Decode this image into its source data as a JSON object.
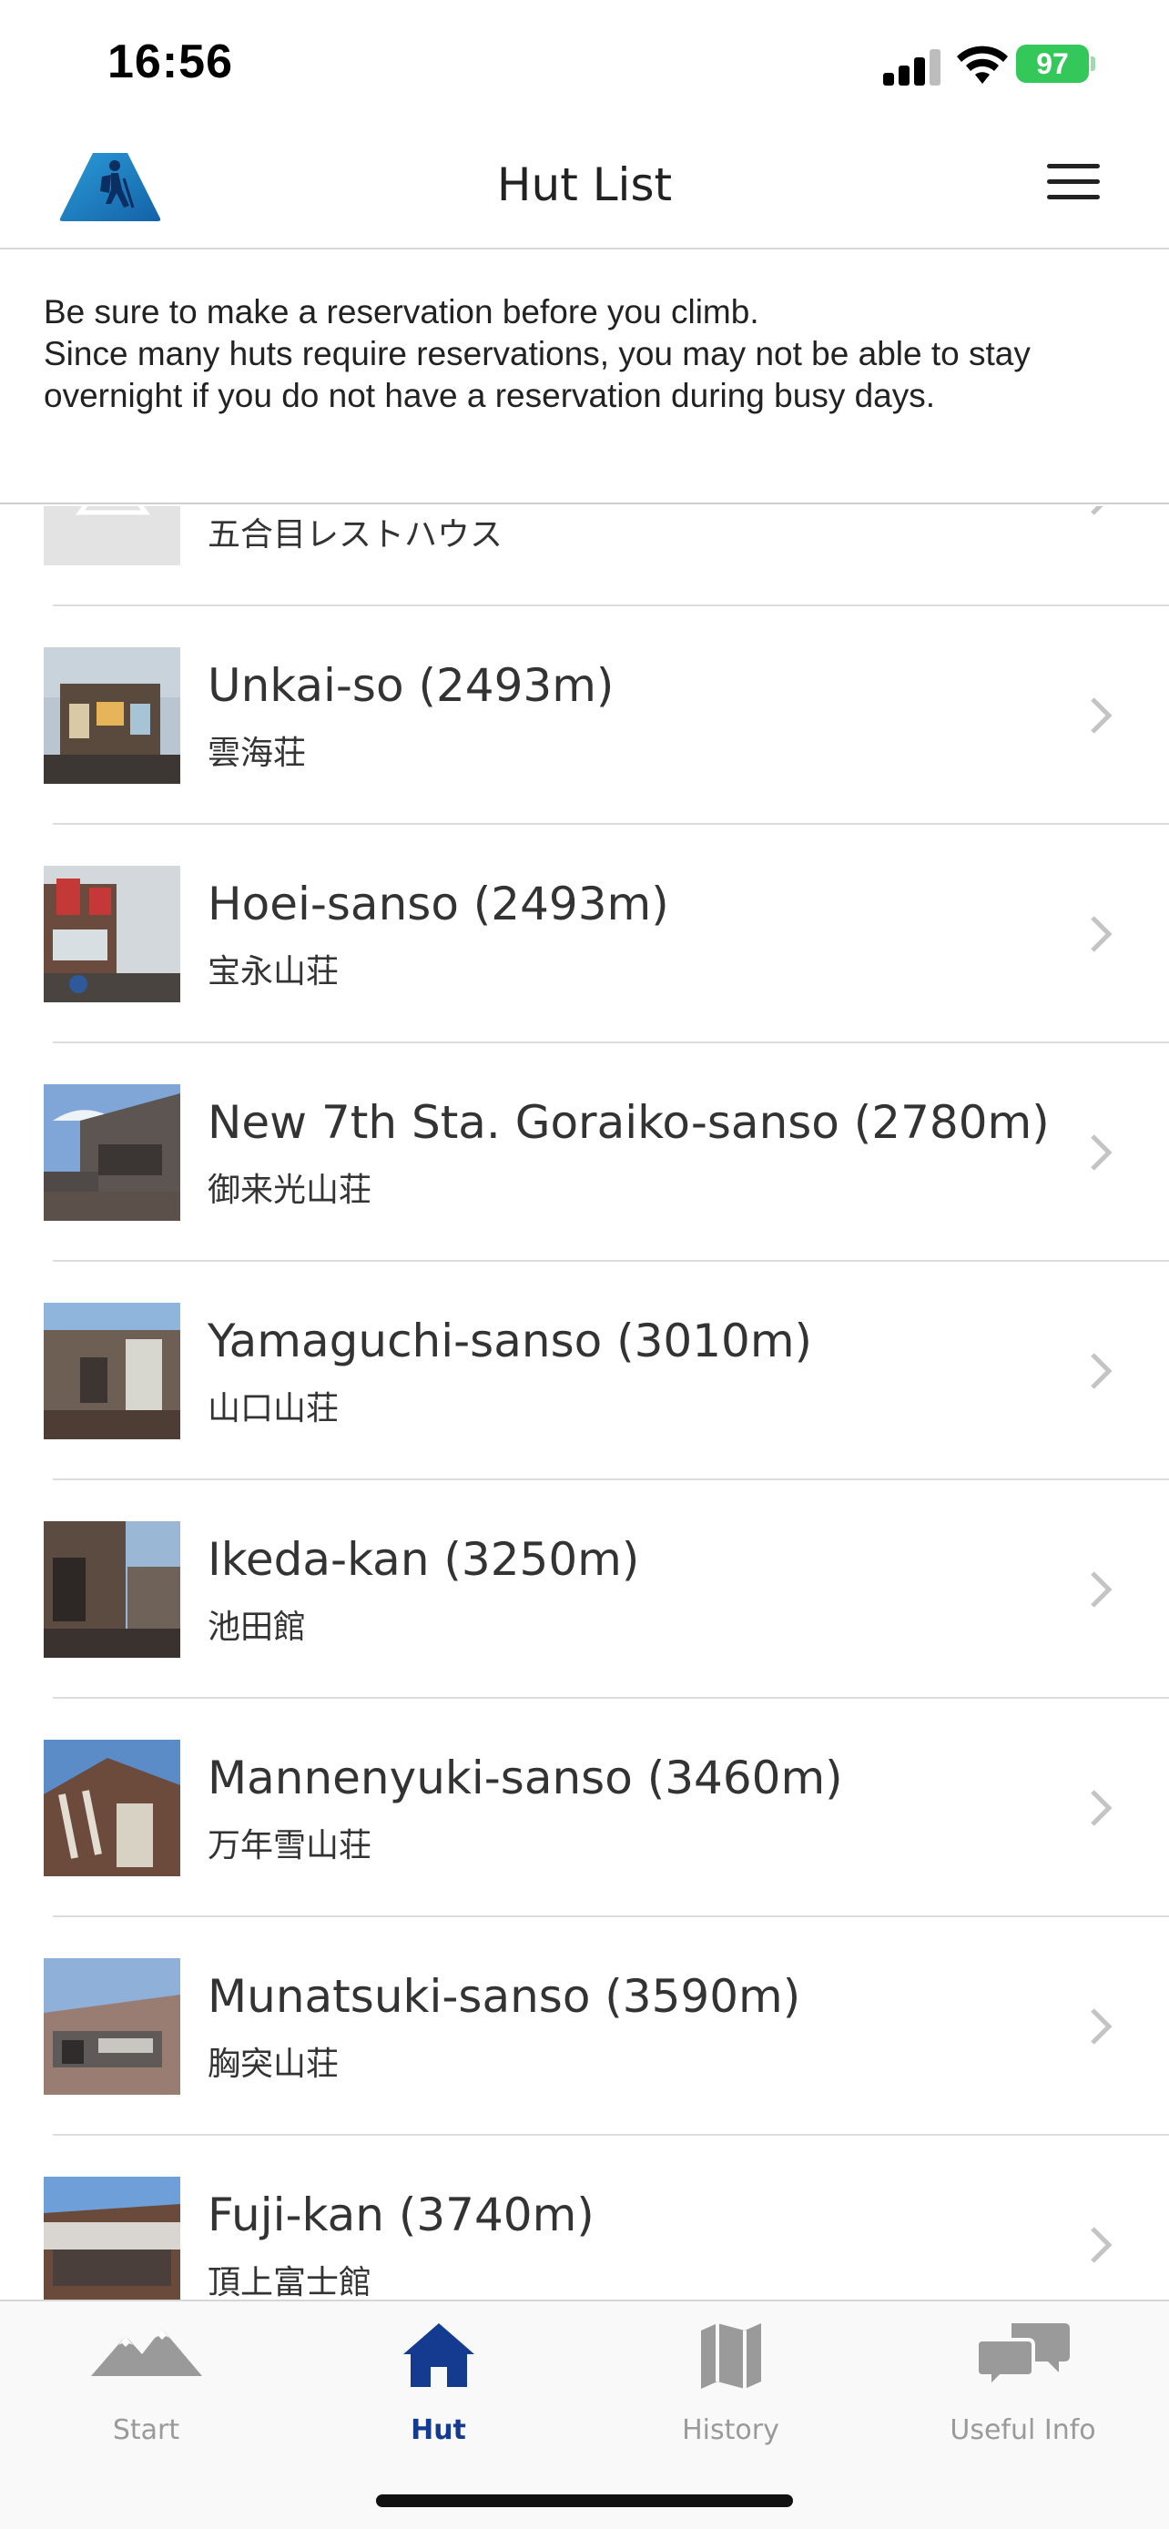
{
  "status_bar": {
    "time": "16:56",
    "battery": "97"
  },
  "header": {
    "title": "Hut List",
    "logo_icon": "mountain-hiker-icon",
    "menu_icon": "hamburger-menu-icon"
  },
  "notice": {
    "line1": "Be sure to make a reservation before you climb.",
    "line2": "Since many huts require reservations, you may not be able to stay overnight if you do not have a reservation during busy days."
  },
  "huts": [
    {
      "name": "",
      "jp": "五合目レストハウス"
    },
    {
      "name": "Unkai-so (2493m)",
      "jp": "雲海荘"
    },
    {
      "name": "Hoei-sanso (2493m)",
      "jp": "宝永山荘"
    },
    {
      "name": "New 7th Sta. Goraiko-sanso (2780m)",
      "jp": "御来光山荘"
    },
    {
      "name": "Yamaguchi-sanso (3010m)",
      "jp": "山口山荘"
    },
    {
      "name": "Ikeda-kan (3250m)",
      "jp": "池田館"
    },
    {
      "name": "Mannenyuki-sanso (3460m)",
      "jp": "万年雪山荘"
    },
    {
      "name": "Munatsuki-sanso (3590m)",
      "jp": "胸突山荘"
    },
    {
      "name": "Fuji-kan (3740m)",
      "jp": "頂上富士館"
    }
  ],
  "tabs": [
    {
      "label": "Start",
      "icon": "mountain-icon"
    },
    {
      "label": "Hut",
      "icon": "house-icon"
    },
    {
      "label": "History",
      "icon": "map-icon"
    },
    {
      "label": "Useful Info",
      "icon": "chat-bubbles-icon"
    }
  ],
  "colors": {
    "accent": "#143b8f",
    "inactive": "#9a9a9a",
    "battery": "#34c759"
  }
}
